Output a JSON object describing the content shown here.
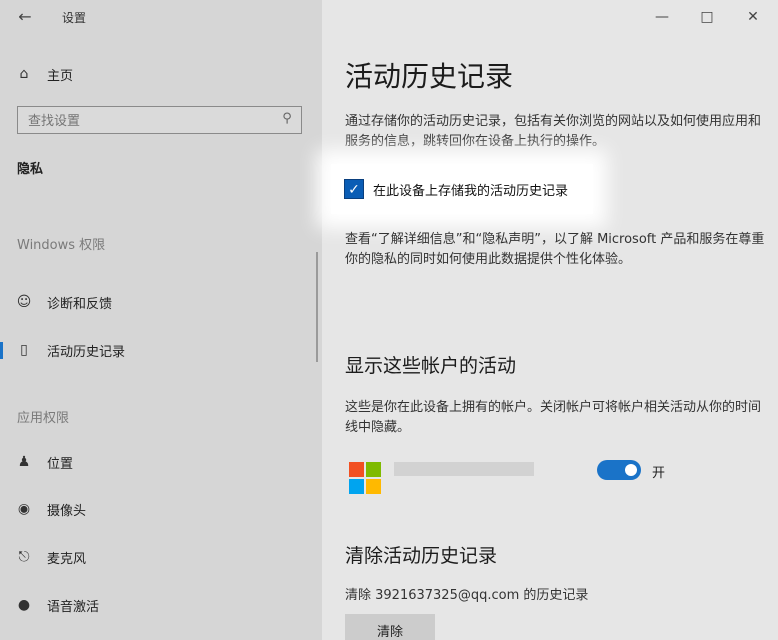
{
  "window": {
    "app_title": "设置",
    "back_icon": "arrow-left-icon",
    "controls": {
      "minimize": "minimize-icon",
      "maximize": "maximize-icon",
      "close": "close-icon"
    }
  },
  "sidebar": {
    "home_label": "主页",
    "search_placeholder": "查找设置",
    "privacy_heading": "隐私",
    "windows_permissions_label": "Windows 权限",
    "windows_items": [
      {
        "label": "诊断和反馈",
        "icon": "feedback-person-icon"
      },
      {
        "label": "活动历史记录",
        "icon": "timeline-icon",
        "active": true
      }
    ],
    "app_permissions_label": "应用权限",
    "app_items": [
      {
        "label": "位置",
        "icon": "location-person-icon"
      },
      {
        "label": "摄像头",
        "icon": "camera-icon"
      },
      {
        "label": "麦克风",
        "icon": "microphone-icon"
      },
      {
        "label": "语音激活",
        "icon": "voice-activation-icon"
      }
    ]
  },
  "main": {
    "title": "活动历史记录",
    "intro": "通过存储你的活动历史记录，包括有关你浏览的网站以及如何使用应用和服务的信息，跳转回你在设备上执行的操作。",
    "checkbox_label": "在此设备上存储我的活动历史记录",
    "checkbox_checked": true,
    "learn_more": "查看“了解详细信息”和“隐私声明”，以了解 Microsoft 产品和服务在尊重你的隐私的同时如何使用此数据提供个性化体验。",
    "accounts_heading": "显示这些帐户的活动",
    "accounts_desc": "这些是你在此设备上拥有的帐户。关闭帐户可将帐户相关活动从你的时间线中隐藏。",
    "account_toggle_state": "开",
    "account_toggle_on": true,
    "clear_heading": "清除活动历史记录",
    "clear_desc": "清除 3921637325@qq.com 的历史记录",
    "clear_button": "清除"
  },
  "colors": {
    "accent": "#1a73c8",
    "ms_red": "#f25022",
    "ms_green": "#7fba00",
    "ms_blue": "#00a4ef",
    "ms_yellow": "#ffb900"
  }
}
